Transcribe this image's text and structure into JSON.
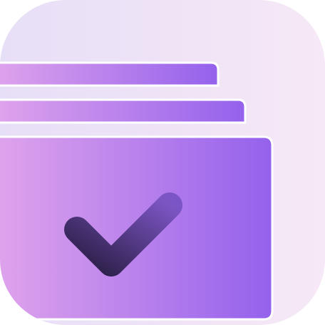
{
  "icon": {
    "name": "stacked-cards-check-icon",
    "colors": {
      "tile_gradient_start": "#e7dff7",
      "tile_gradient_end": "#f6e8f6",
      "card_gradient_start": "#e2a6ec",
      "card_gradient_end": "#9461ec",
      "check_gradient_start": "#2a1e45",
      "check_gradient_end": "#7c55c4",
      "separator": "#ffffff"
    }
  }
}
